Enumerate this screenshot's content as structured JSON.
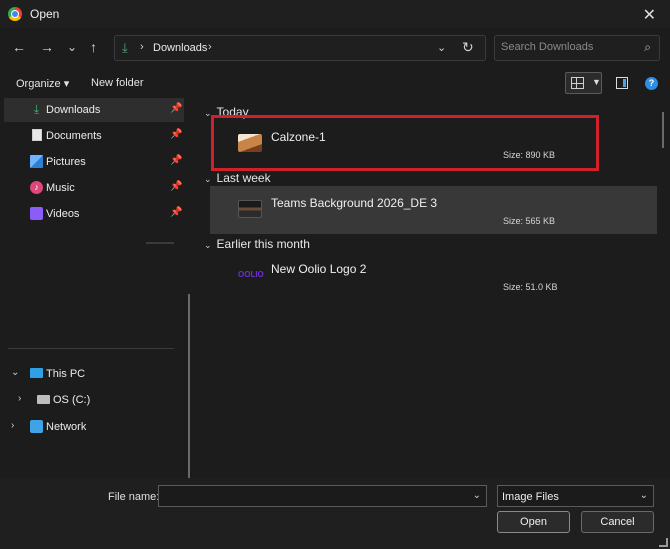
{
  "window": {
    "title": "Open",
    "close_glyph": "✕"
  },
  "nav": {
    "back": "←",
    "forward": "→",
    "recent": "⌄",
    "up": "↑",
    "address": {
      "icon": "download-icon",
      "crumb": "Downloads",
      "sep": "›",
      "dropdown": "⌄",
      "refresh": "↻"
    },
    "search_placeholder": "Search Downloads",
    "search_glyph": "⌕"
  },
  "commandbar": {
    "organize": "Organize ▾",
    "new_folder": "New folder",
    "help": "?"
  },
  "sidebar": {
    "quick": [
      {
        "label": "Downloads",
        "icon": "download-icon",
        "glyph": "⤓",
        "active": true
      },
      {
        "label": "Documents",
        "icon": "document-icon",
        "glyph": "",
        "active": false
      },
      {
        "label": "Pictures",
        "icon": "pictures-icon",
        "glyph": "",
        "active": false
      },
      {
        "label": "Music",
        "icon": "music-icon",
        "glyph": "♪",
        "active": false
      },
      {
        "label": "Videos",
        "icon": "videos-icon",
        "glyph": "",
        "active": false
      }
    ],
    "pin_glyph": "📌",
    "tree": [
      {
        "label": "This PC",
        "expander": "⌄",
        "icon": "computer-icon"
      },
      {
        "label": "OS (C:)",
        "expander": "›",
        "icon": "drive-icon"
      },
      {
        "label": "Network",
        "expander": "›",
        "icon": "network-icon"
      }
    ]
  },
  "groups": [
    {
      "header": "Today",
      "chevron": "⌄",
      "files": [
        {
          "name": "Calzone-1",
          "size": "Size: 890 KB",
          "thumb": "calzone-thumbnail",
          "selected": false
        }
      ]
    },
    {
      "header": "Last week",
      "chevron": "⌄",
      "files": [
        {
          "name": "Teams Background 2026_DE 3",
          "size": "Size: 565 KB",
          "thumb": "teams-background-thumbnail",
          "selected": true
        }
      ]
    },
    {
      "header": "Earlier this month",
      "chevron": "⌄",
      "files": [
        {
          "name": "New Oolio Logo 2",
          "size": "Size: 51.0 KB",
          "thumb": "oolio-logo-thumbnail",
          "thumb_text": "OOLIO",
          "selected": false
        }
      ]
    }
  ],
  "footer": {
    "file_name_label": "File name:",
    "file_name_value": "",
    "file_type": "Image Files",
    "open": "Open",
    "cancel": "Cancel",
    "dropdown": "⌄"
  },
  "colors": {
    "highlight_box": "#d0202a",
    "accent": "#2d8fe3"
  }
}
